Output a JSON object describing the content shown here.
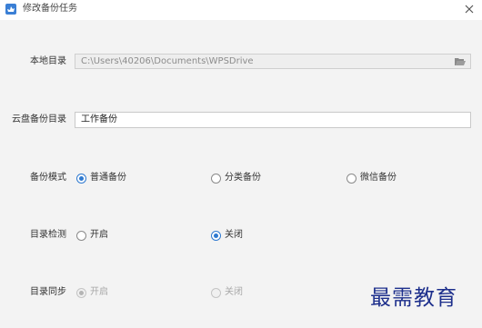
{
  "window": {
    "title": "修改备份任务",
    "app_icon": "wps-cloud-icon",
    "close_icon": "close-icon"
  },
  "local_dir": {
    "label": "本地目录",
    "value": "C:\\Users\\40206\\Documents\\WPSDrive",
    "button_icon": "folder-open-icon"
  },
  "cloud_dir": {
    "label": "云盘备份目录",
    "value": "工作备份"
  },
  "backup_mode": {
    "label": "备份模式",
    "options": [
      {
        "label": "普通备份",
        "checked": true
      },
      {
        "label": "分类备份",
        "checked": false
      },
      {
        "label": "微信备份",
        "checked": false
      }
    ]
  },
  "dir_detect": {
    "label": "目录检测",
    "options": [
      {
        "label": "开启",
        "checked": false
      },
      {
        "label": "关闭",
        "checked": true
      }
    ]
  },
  "dir_sync": {
    "label": "目录同步",
    "disabled": true,
    "options": [
      {
        "label": "开启",
        "checked": true
      },
      {
        "label": "关闭",
        "checked": false
      }
    ]
  },
  "watermark": "最需教育",
  "colors": {
    "accent": "#2f7ad0",
    "background": "#f3f3f3",
    "watermark": "#1d2f8c"
  }
}
